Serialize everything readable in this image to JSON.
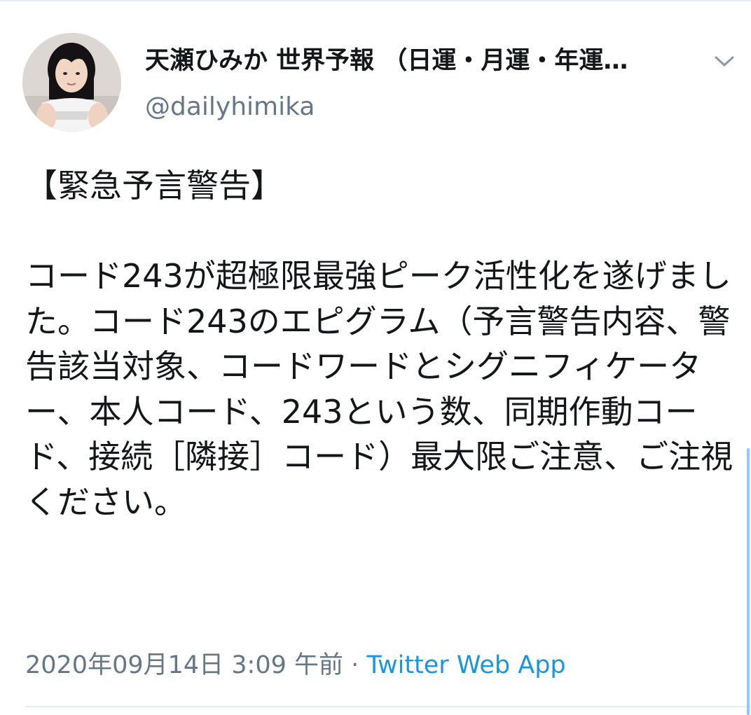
{
  "tweet": {
    "author": {
      "display_name": "天瀬ひみか 世界予報 （日運・月運・年運…",
      "handle": "@dailyhimika",
      "avatar_icon": "profile-photo"
    },
    "menu_icon": "chevron-down-icon",
    "text": "【緊急予言警告】\n\nコード243が超極限最強ピーク活性化を遂げました。コード243のエピグラム（予言警告内容、警告該当対象、コードワードとシグニフィケーター、本人コード、243という数、同期作動コード、接続［隣接］コード）最大限ご注意、ご注視ください。",
    "timestamp": "2020年09月14日 3:09 午前",
    "separator": " · ",
    "source": "Twitter Web App"
  },
  "colors": {
    "text": "#14171a",
    "muted": "#657786",
    "link": "#1b95e0",
    "divider": "#e6ecf0"
  }
}
